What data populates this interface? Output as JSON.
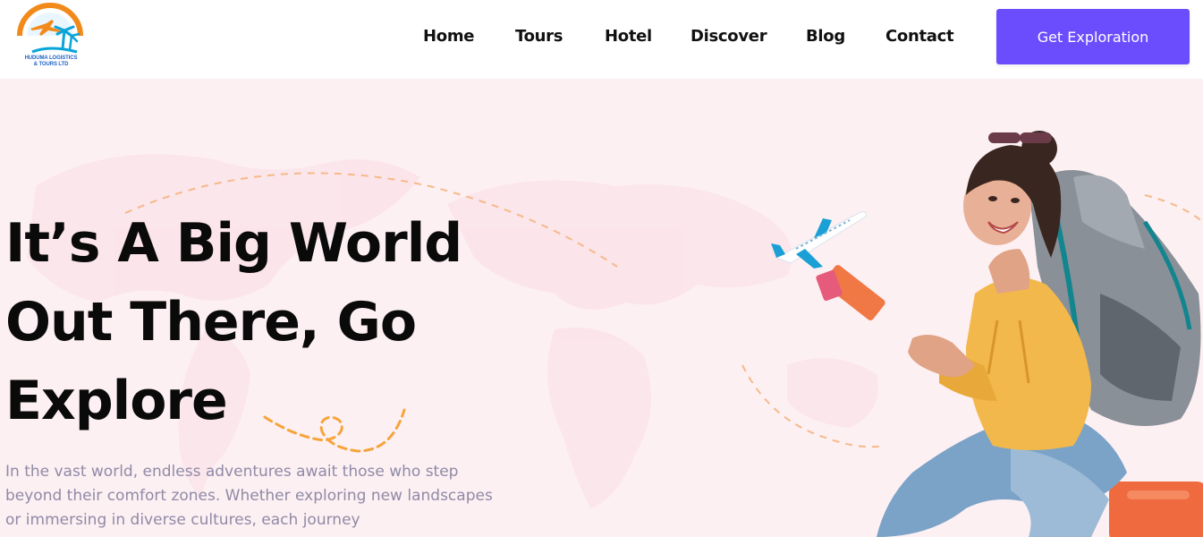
{
  "brand": {
    "name_line1": "HUDUMA LOGISTICS",
    "name_line2": "& TOURS LTD"
  },
  "nav": {
    "items": [
      {
        "label": "Home"
      },
      {
        "label": "Tours"
      },
      {
        "label": "Hotel"
      },
      {
        "label": "Discover"
      },
      {
        "label": "Blog"
      },
      {
        "label": "Contact"
      }
    ],
    "cta_label": "Get Exploration"
  },
  "hero": {
    "headline_line1": "It’s A Big World",
    "headline_line2": "Out There, Go",
    "headline_line3": "Explore",
    "description": "In the vast world, endless adventures await those who step beyond their comfort zones. Whether exploring new landscapes or immersing in diverse cultures, each journey"
  },
  "colors": {
    "accent": "#6c4dfd",
    "hero_bg": "#fdf0f3",
    "heading": "#0a0a0a",
    "body_text": "#8f8aa6",
    "dashed_path": "#f6a43a"
  },
  "icons": [
    "logo-icon",
    "airplane-icon",
    "traveler-image"
  ]
}
